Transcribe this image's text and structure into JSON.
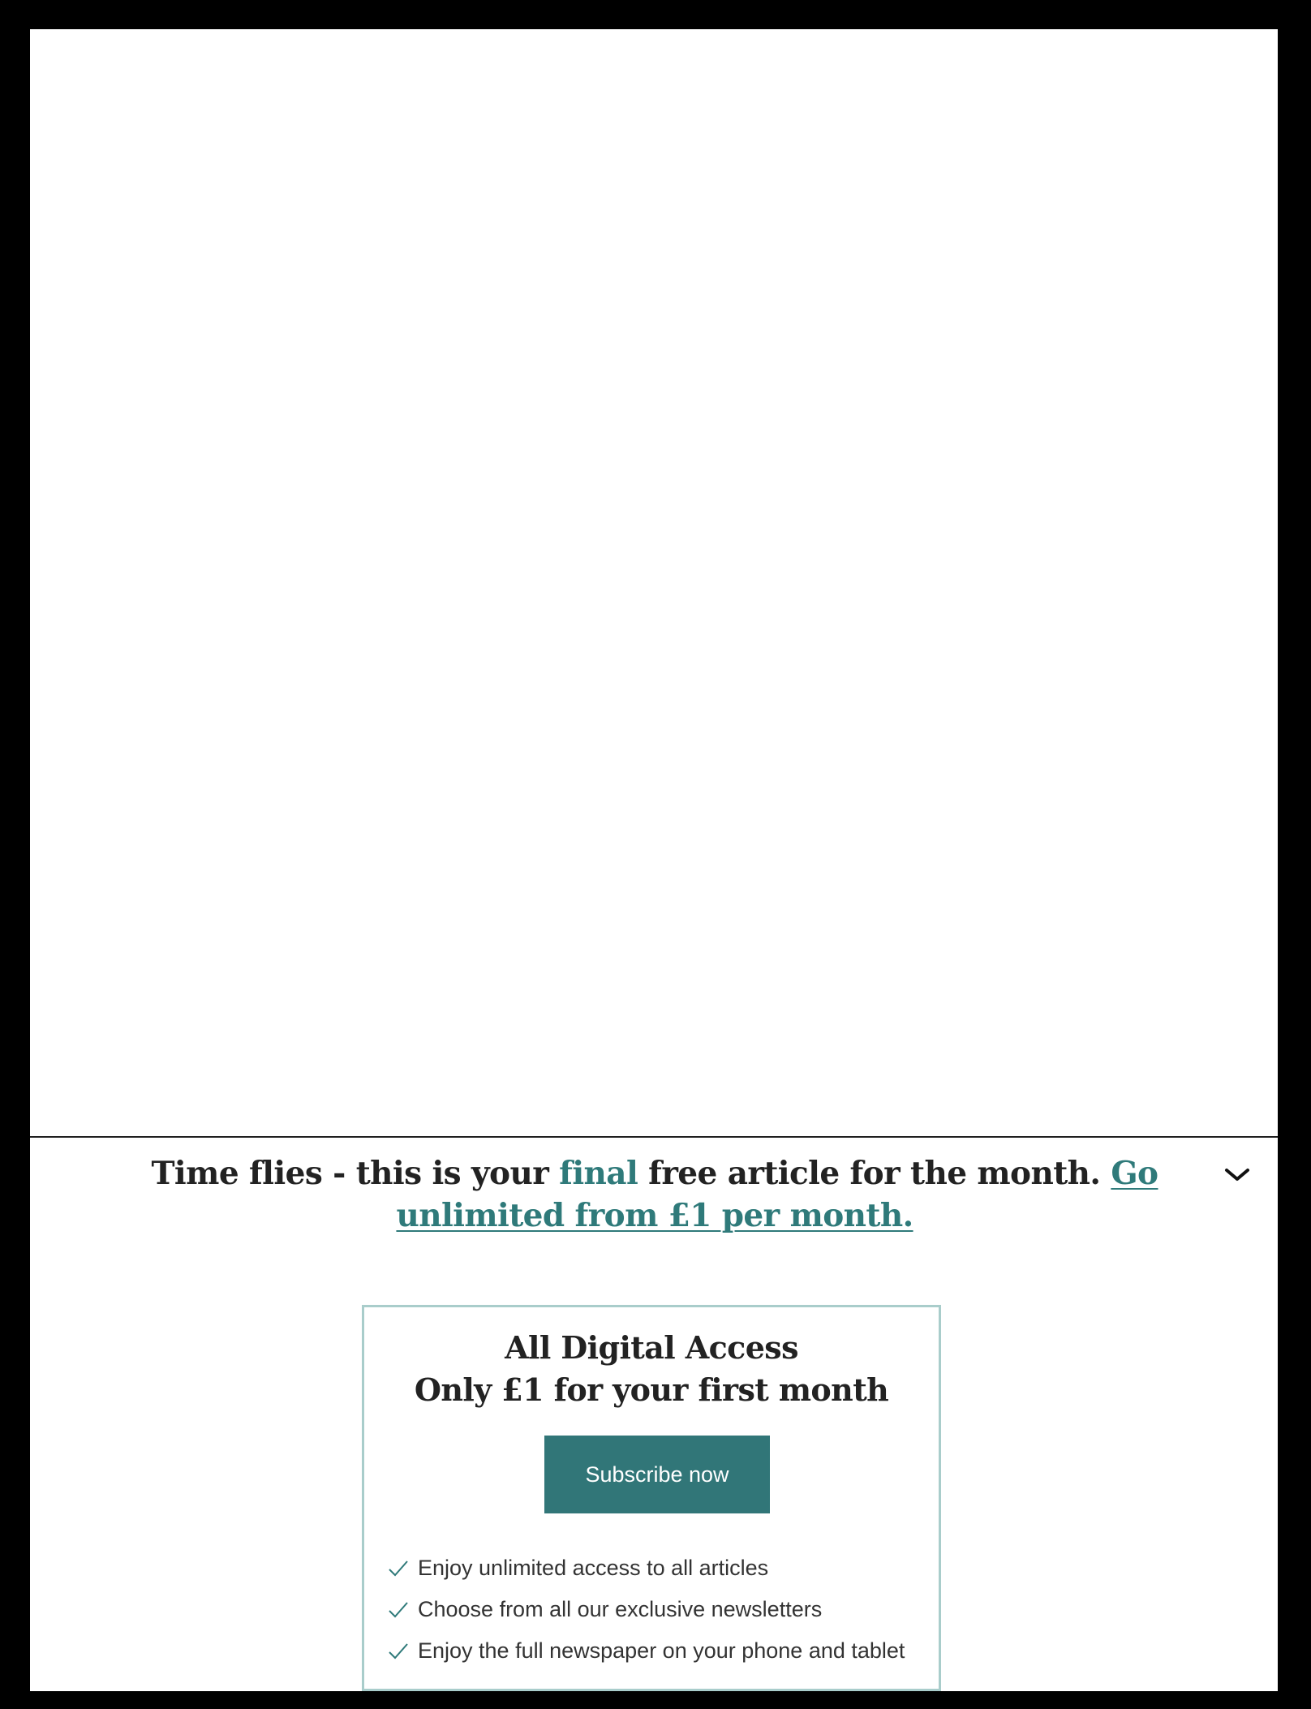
{
  "banner": {
    "headline_part1": "Time flies - this is your ",
    "headline_accent": "final",
    "headline_part2": " free article for the month. ",
    "headline_link": "Go unlimited from £1 per month.",
    "collapse_icon": "chevron-down-icon"
  },
  "offer": {
    "title_line1": "All Digital Access",
    "title_line2": "Only £1 for your first month",
    "cta_label": "Subscribe now",
    "benefits": [
      "Enjoy unlimited access to all articles",
      "Choose from all our exclusive newsletters",
      "Enjoy the full newspaper on your phone and tablet"
    ],
    "benefit_icon": "check-icon"
  },
  "colors": {
    "accent": "#2f7a7a",
    "button": "#317678",
    "box_border": "#a9cdcb",
    "text": "#222222",
    "outer_background": "#000000"
  }
}
